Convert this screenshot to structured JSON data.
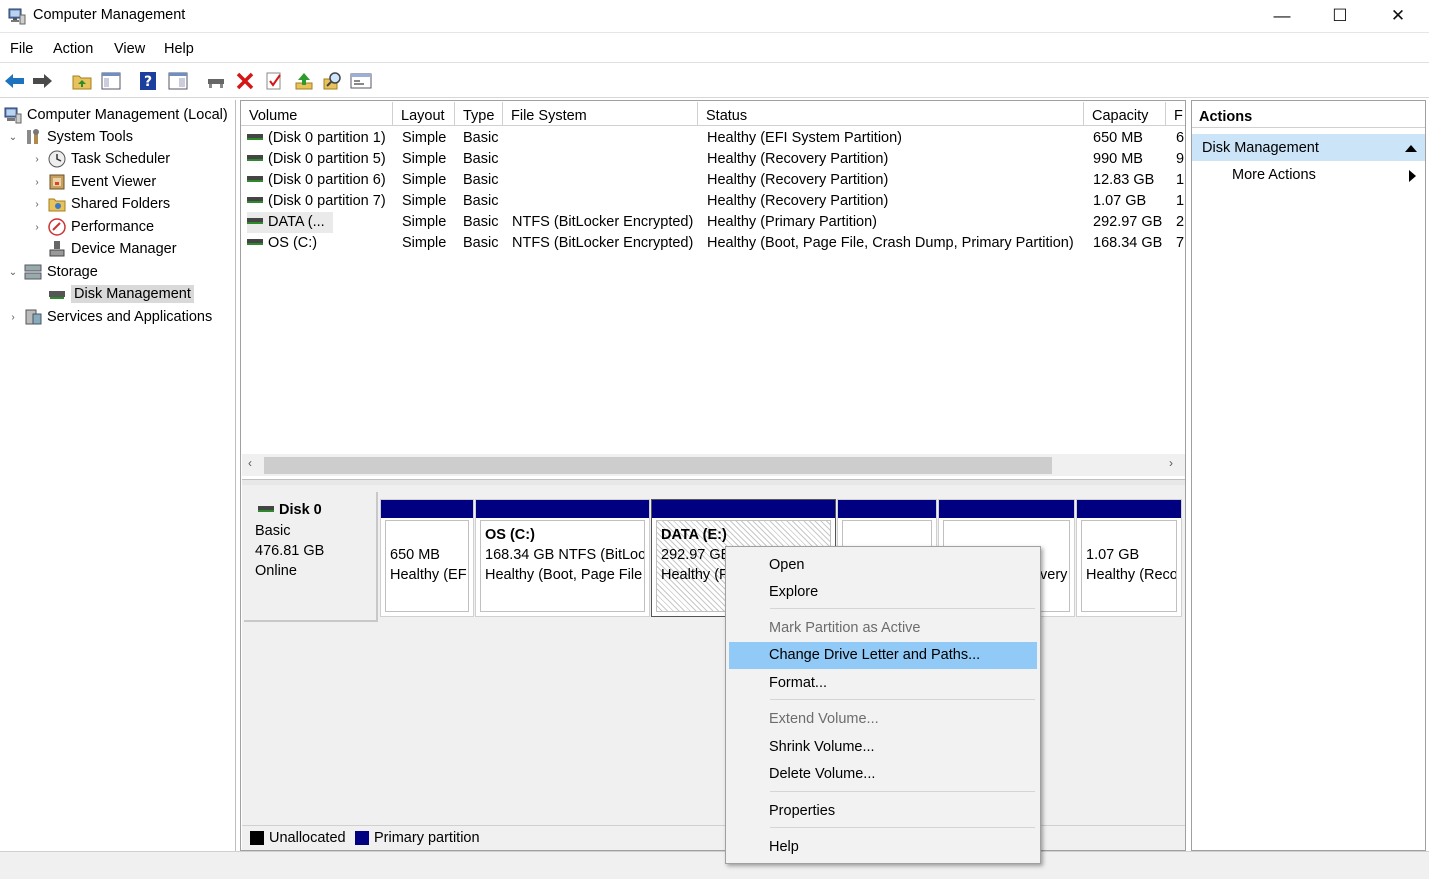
{
  "window": {
    "title": "Computer Management",
    "minimize_glyph": "—",
    "maximize_glyph": "☐",
    "close_glyph": "✕"
  },
  "menubar": {
    "items": [
      "File",
      "Action",
      "View",
      "Help"
    ]
  },
  "toolbar": {
    "icons": [
      "back-arrow-icon",
      "forward-arrow-icon",
      "up-folder-icon",
      "show-hide-console-tree-icon",
      "help-icon",
      "properties-view-icon",
      "connect-drive-icon",
      "delete-icon",
      "check-properties-icon",
      "up-arrow-icon",
      "search-icon",
      "new-window-icon"
    ]
  },
  "tree": {
    "root": "Computer Management (Local)",
    "system_tools": "System Tools",
    "task_scheduler": "Task Scheduler",
    "event_viewer": "Event Viewer",
    "shared_folders": "Shared Folders",
    "performance": "Performance",
    "device_manager": "Device Manager",
    "storage": "Storage",
    "disk_management": "Disk Management",
    "services": "Services and Applications"
  },
  "volumes": {
    "headers": {
      "volume": "Volume",
      "layout": "Layout",
      "type": "Type",
      "fs": "File System",
      "status": "Status",
      "capacity": "Capacity",
      "free": "F"
    },
    "rows": [
      {
        "volume": "(Disk 0 partition 1)",
        "layout": "Simple",
        "type": "Basic",
        "fs": "",
        "status": "Healthy (EFI System Partition)",
        "capacity": "650 MB",
        "free": "6"
      },
      {
        "volume": "(Disk 0 partition 5)",
        "layout": "Simple",
        "type": "Basic",
        "fs": "",
        "status": "Healthy (Recovery Partition)",
        "capacity": "990 MB",
        "free": "9"
      },
      {
        "volume": "(Disk 0 partition 6)",
        "layout": "Simple",
        "type": "Basic",
        "fs": "",
        "status": "Healthy (Recovery Partition)",
        "capacity": "12.83 GB",
        "free": "1"
      },
      {
        "volume": "(Disk 0 partition 7)",
        "layout": "Simple",
        "type": "Basic",
        "fs": "",
        "status": "Healthy (Recovery Partition)",
        "capacity": "1.07 GB",
        "free": "1"
      },
      {
        "volume": "DATA (...",
        "layout": "Simple",
        "type": "Basic",
        "fs": "NTFS (BitLocker Encrypted)",
        "status": "Healthy (Primary Partition)",
        "capacity": "292.97 GB",
        "free": "2"
      },
      {
        "volume": "OS (C:)",
        "layout": "Simple",
        "type": "Basic",
        "fs": "NTFS (BitLocker Encrypted)",
        "status": "Healthy (Boot, Page File, Crash Dump, Primary Partition)",
        "capacity": "168.34 GB",
        "free": "7"
      }
    ],
    "scroll_left": "‹",
    "scroll_right": "›"
  },
  "disk": {
    "name": "Disk 0",
    "type": "Basic",
    "size": "476.81 GB",
    "status": "Online",
    "partitions": [
      {
        "title": "",
        "line1": "650 MB",
        "line2": "Healthy (EF"
      },
      {
        "title": "OS  (C:)",
        "line1": "168.34 GB NTFS (BitLoc",
        "line2": "Healthy (Boot, Page File"
      },
      {
        "title": "DATA  (E:)",
        "line1": "292.97 GB",
        "line2": "Healthy (F"
      },
      {
        "title": "",
        "line1": "",
        "line2": ""
      },
      {
        "title": "",
        "line1": "",
        "line2": "very"
      },
      {
        "title": "",
        "line1": "1.07 GB",
        "line2": "Healthy (Reco"
      }
    ]
  },
  "legend": {
    "unallocated": "Unallocated",
    "primary": "Primary partition",
    "unallocated_color": "#000000",
    "primary_color": "#000080"
  },
  "actions": {
    "header": "Actions",
    "section": "Disk Management",
    "more": "More Actions"
  },
  "context_menu": {
    "open": "Open",
    "explore": "Explore",
    "mark_active": "Mark Partition as Active",
    "change_letter": "Change Drive Letter and Paths...",
    "format": "Format...",
    "extend": "Extend Volume...",
    "shrink": "Shrink Volume...",
    "delete": "Delete Volume...",
    "properties": "Properties",
    "help": "Help"
  }
}
